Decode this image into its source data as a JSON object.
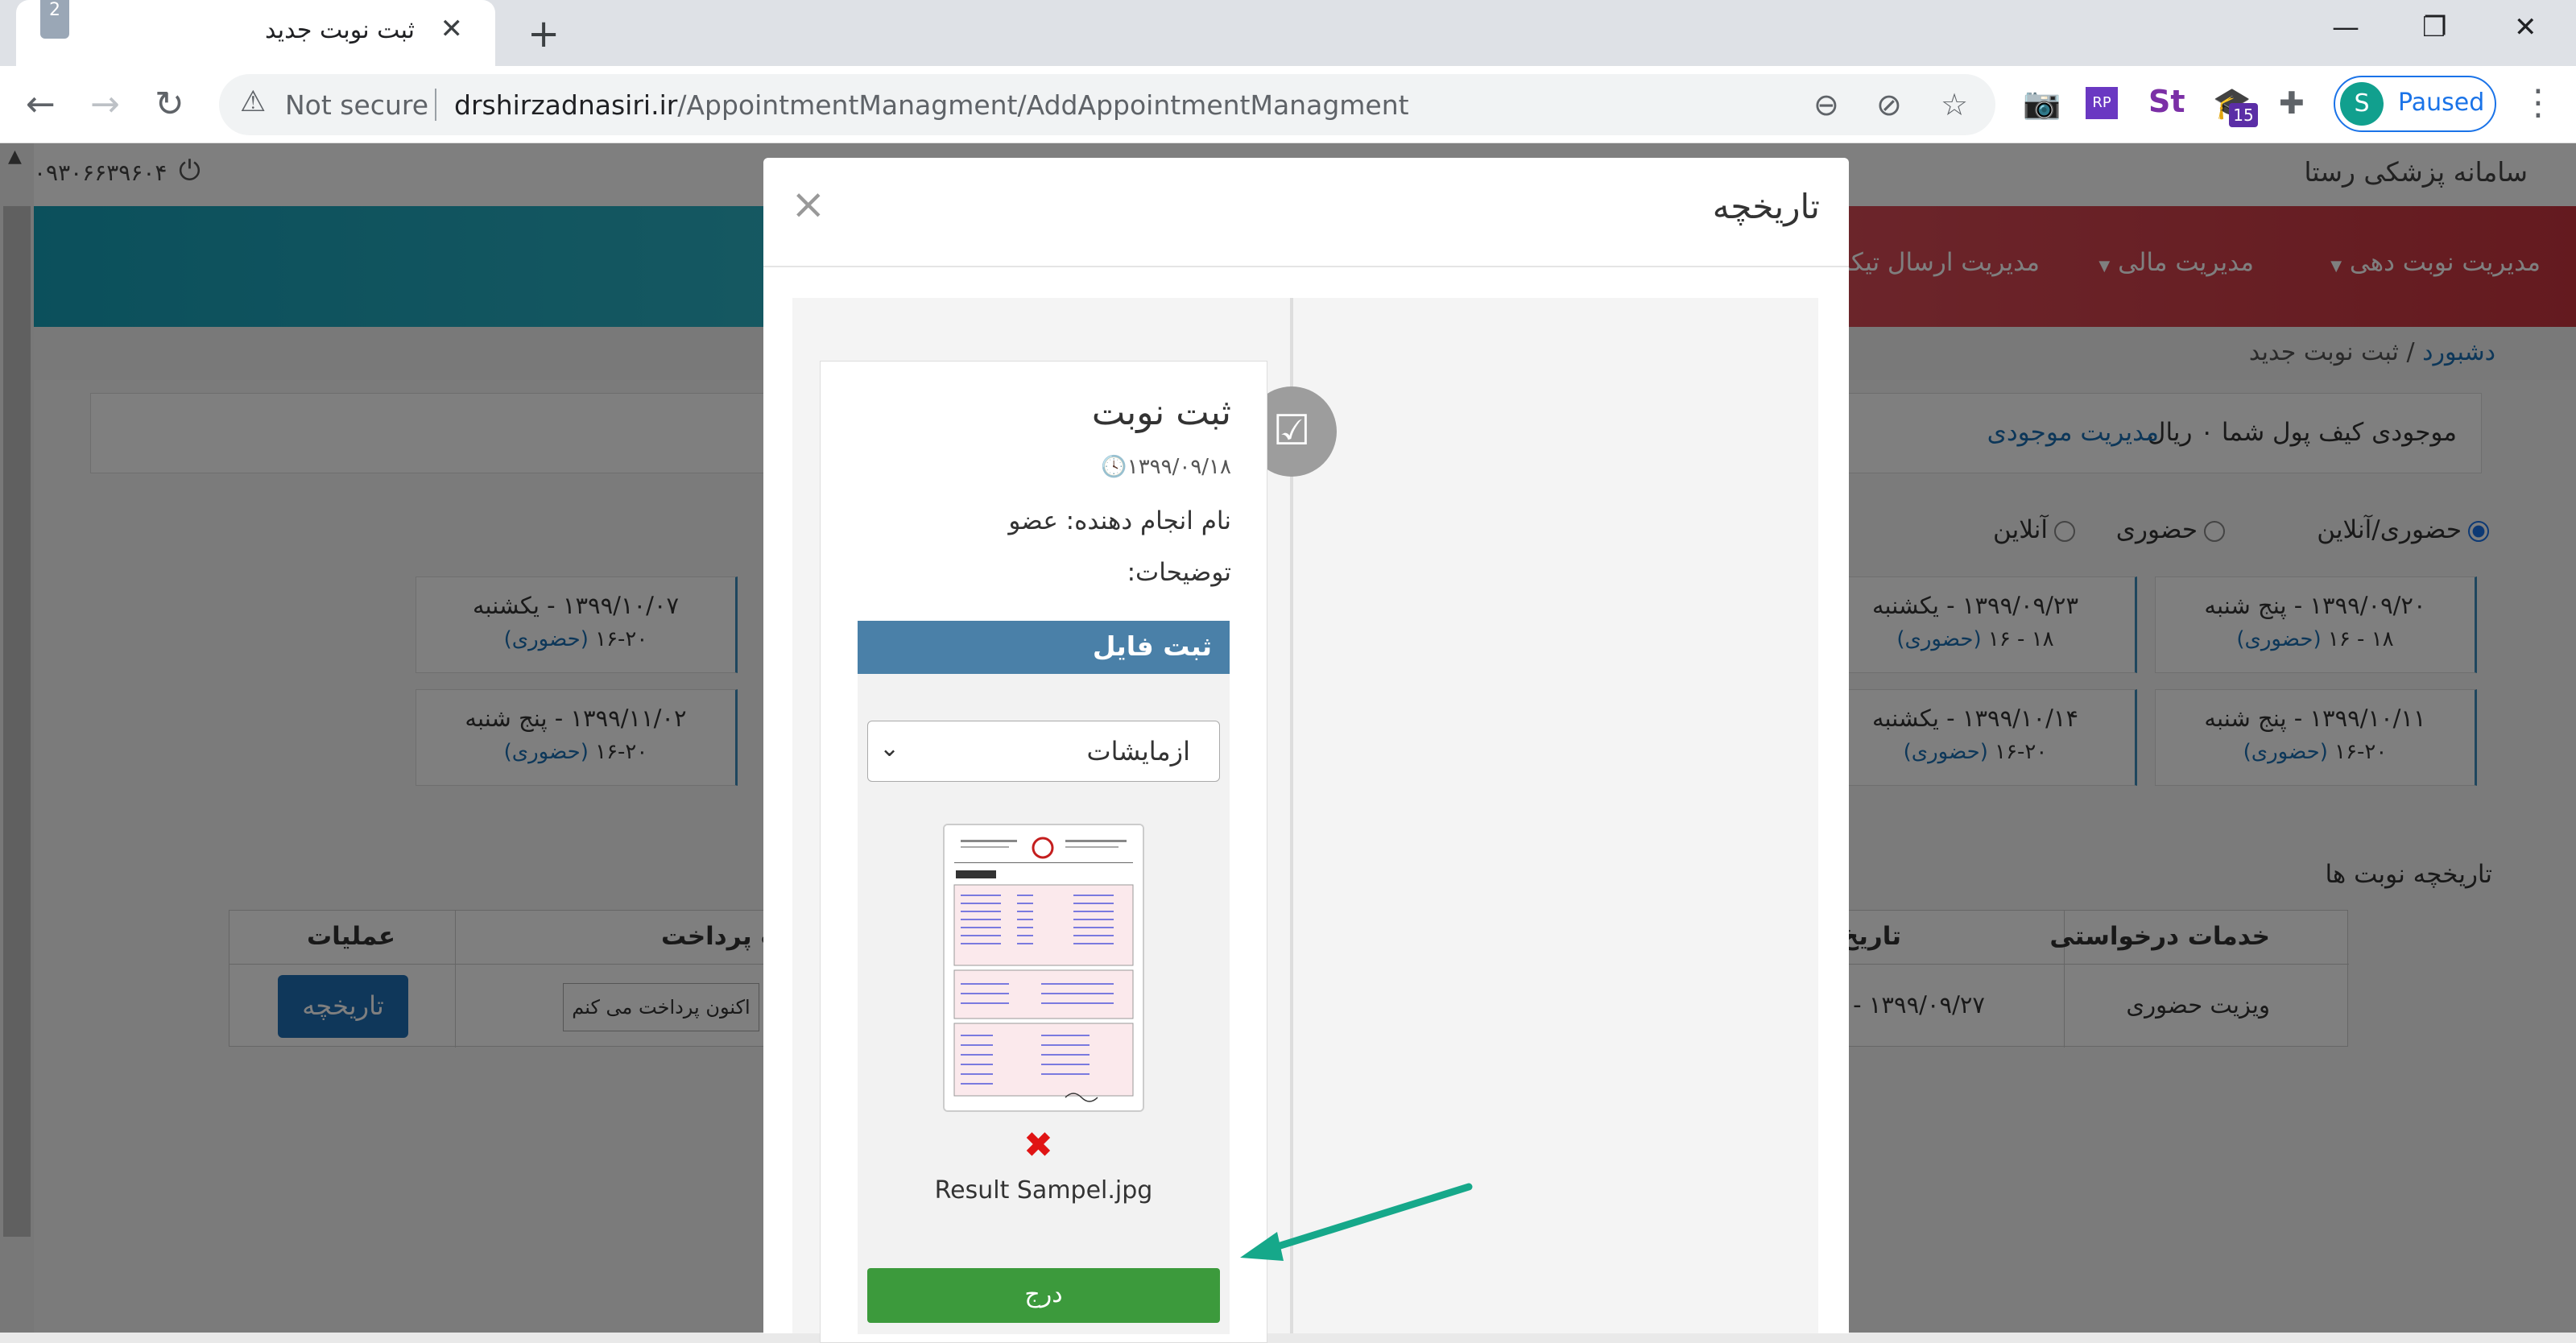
{
  "browser": {
    "tab_title": "ثبت نوبت جدید",
    "tab_badge": "2",
    "not_secure": "Not secure",
    "url_domain": "drshirzadnasiri.ir",
    "url_path": "/AppointmentManagment/AddAppointmentManagment",
    "profile_initial": "S",
    "profile_status": "Paused",
    "extension_badge": "15",
    "rp_label": "RP",
    "st_label": "St"
  },
  "site": {
    "title": "سامانه پزشکی رستا",
    "user_phone": "۰۹۳۰۶۶۳۹۶۰۴"
  },
  "nav": {
    "appointments": "مدیریت نوبت دهی",
    "finance": "مدیریت مالی",
    "tickets": "مدیریت ارسال تیکت"
  },
  "breadcrumb": {
    "home": "دشبورد",
    "separator": "/",
    "current": "ثبت نوبت جدید"
  },
  "wallet": {
    "text": "موجودی کیف پول شما ۰ ریال",
    "link": "مدیریت موجودی"
  },
  "visit_type": {
    "both": "حضوری/آنلاین",
    "in_person": "حضوری",
    "online": "آنلاین"
  },
  "slots": [
    {
      "date": "۱۳۹۹/۰۹/۲۰ - پنج شنبه",
      "time": "۱۶ - ۱۸",
      "type": "(حضوری)"
    },
    {
      "date": "۱۳۹۹/۰۹/۲۳ - یکشنبه",
      "time": "۱۶ - ۱۸",
      "type": "(حضوری)"
    },
    {
      "date": "۱۳۹۹/۱۰/۰۷ - یکشنبه",
      "time": "۱۶-۲۰",
      "type": "(حضوری)"
    },
    {
      "date": "۱۳۹۹/۱۰/۱۱ - پنج شنبه",
      "time": "۱۶-۲۰",
      "type": "(حضوری)"
    },
    {
      "date": "۱۳۹۹/۱۰/۱۴ - یکشنبه",
      "time": "۱۶-۲۰",
      "type": "(حضوری)"
    },
    {
      "date": "۱۳۹۹/۱۱/۰۲ - پنج شنبه",
      "time": "۱۶-۲۰",
      "type": "(حضوری)"
    }
  ],
  "history": {
    "title": "تاریخچه نوبت ها",
    "headers": {
      "services": "خدمات درخواستی",
      "date": "تاریخ",
      "payment": "ت پرداخت",
      "actions": "عملیات"
    },
    "row": {
      "service": "ویزیت حضوری",
      "date": "۱۳۹۹/۰۹/۲۷ -",
      "pay_button": "اکنون پرداخت می کنم",
      "history_button": "تاریخچه"
    }
  },
  "modal": {
    "title": "تاریخچه",
    "close": "×",
    "card": {
      "title": "ثبت نوبت",
      "date": "۱۳۹۹/۰۹/۱۸",
      "performer": "نام انجام دهنده: عضو",
      "description": "توضیحات:",
      "file_header": "ثبت فایل",
      "file_type": "ازمایشات",
      "file_name": "Result Sampel.jpg",
      "submit": "درج"
    }
  },
  "colors": {
    "accent": "#1f6fb5",
    "file_header": "#4a80a8",
    "submit": "#3c9a3c",
    "delete": "#e01414",
    "arrow": "#16a88a"
  }
}
